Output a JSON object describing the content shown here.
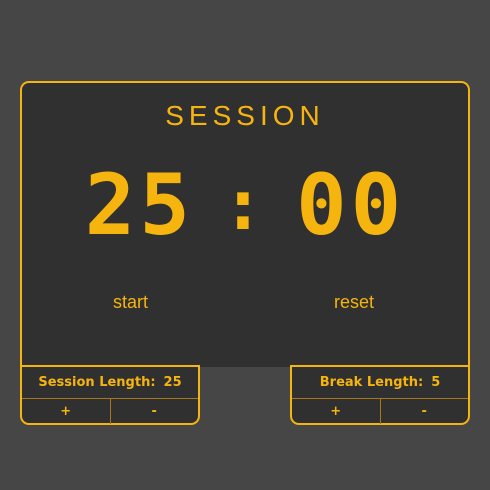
{
  "session_title": "SESSION",
  "timer": {
    "minutes": "25",
    "separator": ":",
    "seconds": "00"
  },
  "controls": {
    "start_label": "start",
    "reset_label": "reset"
  },
  "session_panel": {
    "label": "Session Length:",
    "value": "25",
    "increment_label": "+",
    "decrement_label": "-"
  },
  "break_panel": {
    "label": "Break Length:",
    "value": "5",
    "increment_label": "+",
    "decrement_label": "-"
  },
  "colors": {
    "accent": "#f6b40f",
    "background": "#464646",
    "panel": "#303030"
  }
}
